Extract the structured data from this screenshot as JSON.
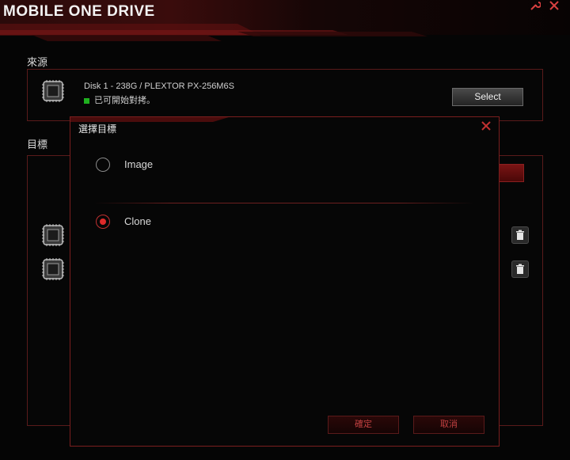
{
  "app": {
    "title": "MOBILE ONE DRIVE"
  },
  "source": {
    "label": "來源",
    "disk_name": "Disk 1 - 238G / PLEXTOR PX-256M6S",
    "disk_status": "已可開始對拷。",
    "select_label": "Select"
  },
  "destination": {
    "label": "目標"
  },
  "dialog": {
    "title": "選擇目標",
    "options": [
      {
        "label": "Image",
        "selected": false
      },
      {
        "label": "Clone",
        "selected": true
      }
    ],
    "confirm_label": "確定",
    "cancel_label": "取消"
  },
  "colors": {
    "accent": "#c02020",
    "status_ok": "#1fb01f"
  }
}
